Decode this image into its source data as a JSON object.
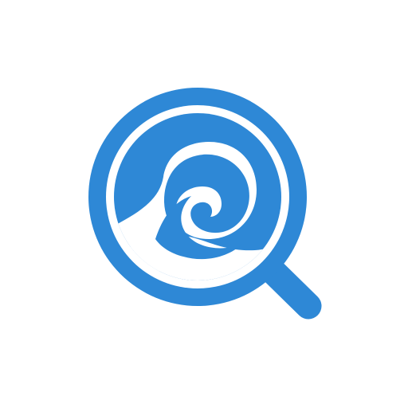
{
  "app_icon": {
    "icon": "wave-magnifier-icon",
    "colors": {
      "background": "#ffffff",
      "brand_blue": "#2E88D6",
      "inner": "#ffffff"
    }
  }
}
